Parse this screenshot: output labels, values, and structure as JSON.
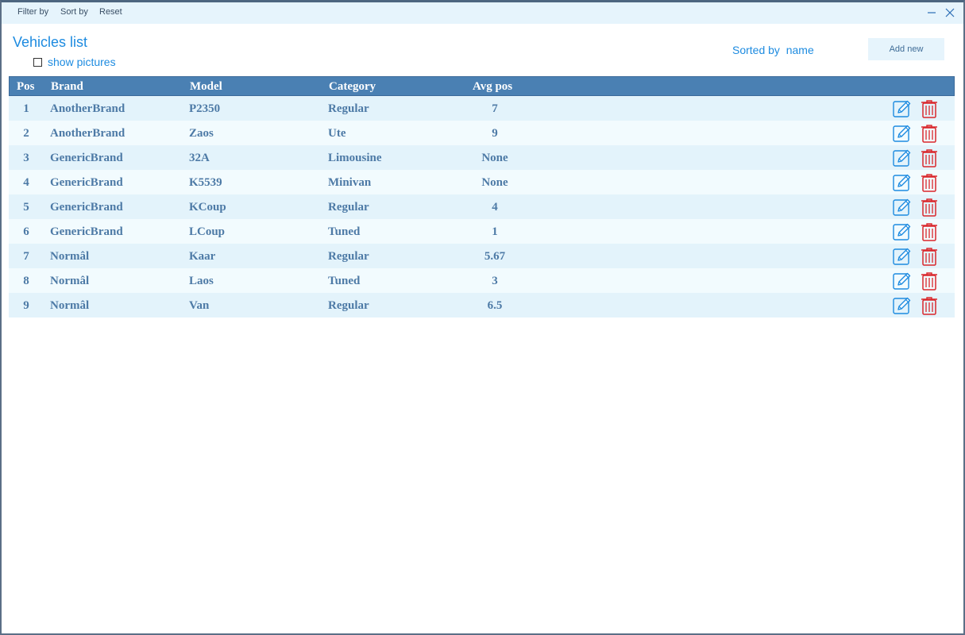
{
  "toolbar": {
    "filter_label": "Filter by",
    "sort_label": "Sort by",
    "reset_label": "Reset"
  },
  "header": {
    "title": "Vehicles list",
    "show_pictures_label": "show pictures",
    "show_pictures_checked": false,
    "sorted_by_label": "Sorted by",
    "sorted_by_value": "name",
    "add_new_label": "Add new"
  },
  "table": {
    "columns": [
      "Pos",
      "Brand",
      "Model",
      "Category",
      "Avg pos"
    ],
    "rows": [
      {
        "pos": "1",
        "brand": "AnotherBrand",
        "model": "P2350",
        "category": "Regular",
        "avg": "7"
      },
      {
        "pos": "2",
        "brand": "AnotherBrand",
        "model": "Zaos",
        "category": "Ute",
        "avg": "9"
      },
      {
        "pos": "3",
        "brand": "GenericBrand",
        "model": "32A",
        "category": "Limousine",
        "avg": "None"
      },
      {
        "pos": "4",
        "brand": "GenericBrand",
        "model": "K5539",
        "category": "Minivan",
        "avg": "None"
      },
      {
        "pos": "5",
        "brand": "GenericBrand",
        "model": "KCoup",
        "category": "Regular",
        "avg": "4"
      },
      {
        "pos": "6",
        "brand": "GenericBrand",
        "model": "LCoup",
        "category": "Tuned",
        "avg": "1"
      },
      {
        "pos": "7",
        "brand": "Normâl",
        "model": "Kaar",
        "category": "Regular",
        "avg": "5.67"
      },
      {
        "pos": "8",
        "brand": "Normâl",
        "model": "Laos",
        "category": "Tuned",
        "avg": "3"
      },
      {
        "pos": "9",
        "brand": "Normâl",
        "model": "Van",
        "category": "Regular",
        "avg": "6.5"
      }
    ],
    "row_actions": [
      "edit-icon",
      "trash-icon"
    ]
  },
  "colors": {
    "accent": "#1d8be0",
    "header_bg": "#4a80b3",
    "row_odd": "#e3f3fb",
    "row_even": "#f2fbfe",
    "delete": "#d9262b"
  }
}
